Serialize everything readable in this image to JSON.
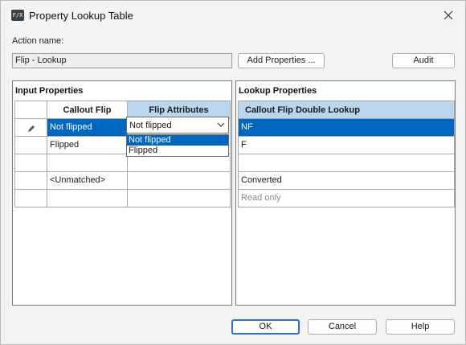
{
  "window": {
    "title": "Property Lookup Table",
    "icon_text": "F/X"
  },
  "action": {
    "label": "Action name:",
    "value": "Flip - Lookup"
  },
  "buttons": {
    "add_properties": "Add Properties ...",
    "audit": "Audit",
    "ok": "OK",
    "cancel": "Cancel",
    "help": "Help"
  },
  "input_properties": {
    "title": "Input Properties",
    "columns": [
      "Callout Flip",
      "Flip Attributes"
    ],
    "rows": [
      {
        "callout_flip": "Not flipped",
        "flip_attributes": "Not flipped"
      },
      {
        "callout_flip": "Flipped",
        "flip_attributes": ""
      },
      {
        "callout_flip": "",
        "flip_attributes": ""
      },
      {
        "callout_flip": "<Unmatched>",
        "flip_attributes": ""
      },
      {
        "callout_flip": "",
        "flip_attributes": ""
      }
    ],
    "dropdown": {
      "value": "Not flipped",
      "options": [
        "Not flipped",
        "Flipped"
      ],
      "selected_index": 0
    }
  },
  "lookup_properties": {
    "title": "Lookup Properties",
    "columns": [
      "Callout Flip Double Lookup"
    ],
    "rows": [
      "NF",
      "F",
      "",
      "Converted",
      "Read only"
    ]
  },
  "colors": {
    "selection": "#0067c0",
    "active_header": "#b8d6f0",
    "default_button_border": "#2e6fd6"
  }
}
